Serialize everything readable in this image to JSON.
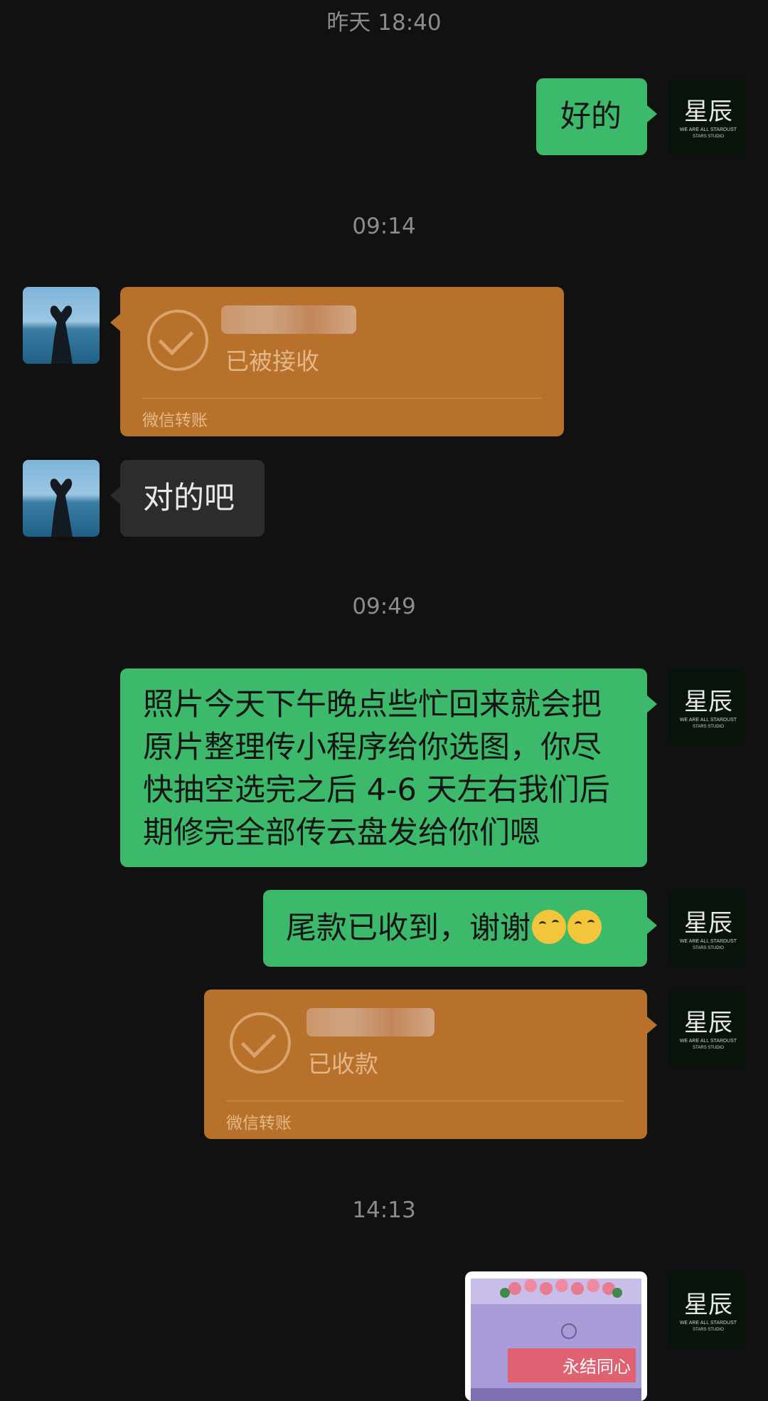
{
  "timestamps": [
    "昨天 18:40",
    "09:14",
    "09:49",
    "14:13"
  ],
  "messages": {
    "m1": "好的",
    "m3": "对的吧",
    "m4": "照片今天下午晚点些忙回来就会把原片整理传小程序给你选图，你尽快抽空选完之后 4-6 天左右我们后期修完全部传云盘发给你们嗯",
    "m5": "尾款已收到，谢谢"
  },
  "transfers": {
    "t1": {
      "status": "已被接收",
      "footer": "微信转账"
    },
    "t2": {
      "status": "已收款",
      "footer": "微信转账"
    }
  },
  "avatar_me": {
    "logo_text": "星辰",
    "line1": "WE ARE ALL STARDUST",
    "line2": "STARS STUDIO"
  },
  "photo_banner": "永结同心",
  "colors": {
    "background": "#111111",
    "green_bubble": "#3cb96a",
    "transfer": "#b8712b"
  }
}
